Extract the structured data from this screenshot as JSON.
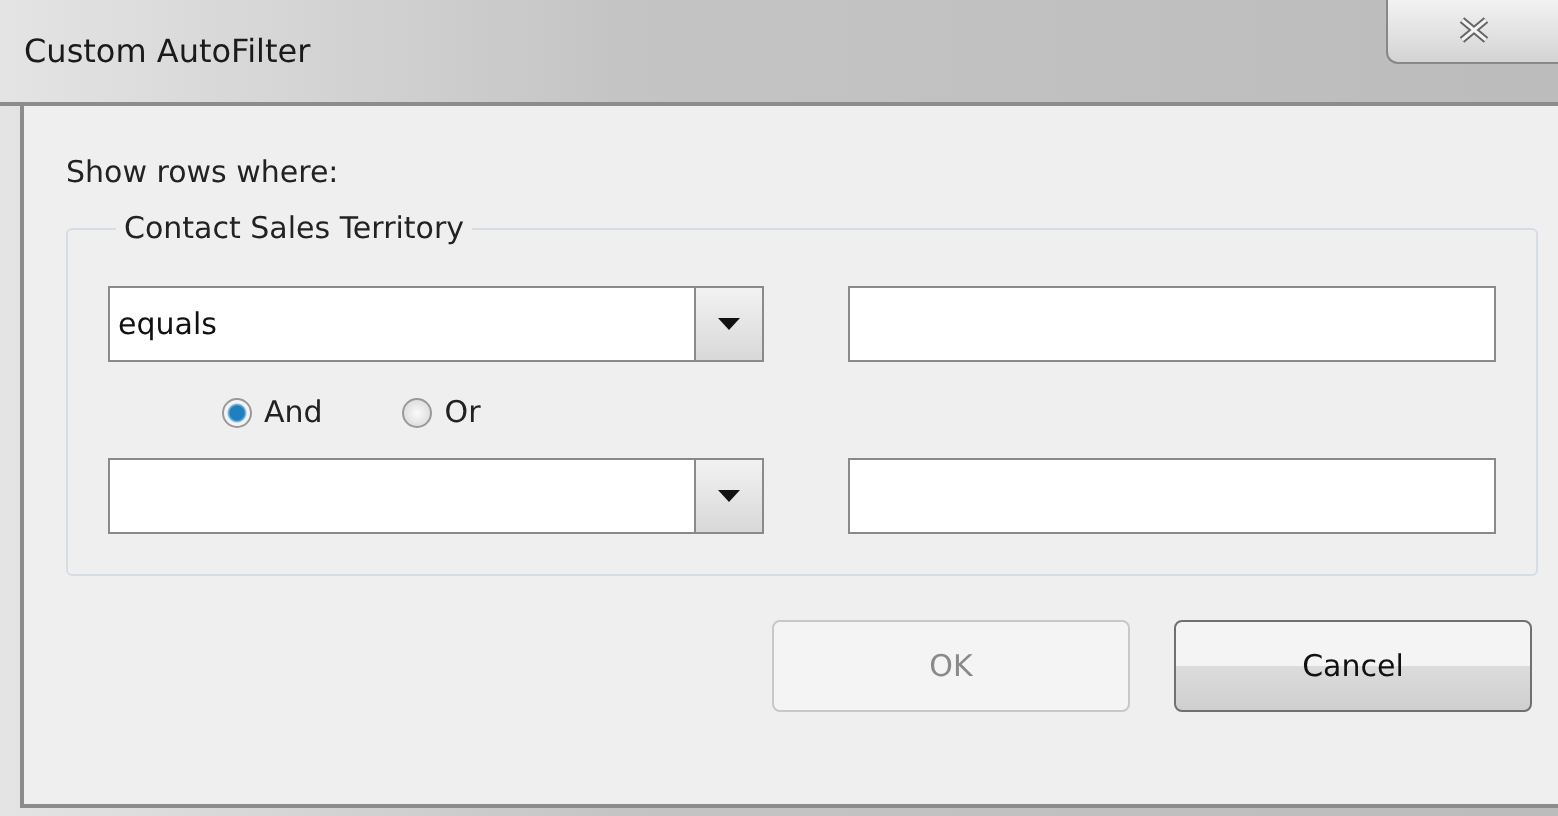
{
  "window": {
    "title": "Custom AutoFilter"
  },
  "prompt": "Show rows where:",
  "group": {
    "label": "Contact Sales Territory",
    "criteria": [
      {
        "kind": "condition",
        "operator": "equals"
      },
      {
        "kind": "condition"
      }
    ],
    "logic": [
      {
        "label": "And",
        "selected": true
      },
      {
        "label": "Or",
        "selected": false
      }
    ]
  },
  "buttons": [
    {
      "label": "OK",
      "disabled": true
    },
    {
      "label": "Cancel",
      "disabled": false
    }
  ]
}
